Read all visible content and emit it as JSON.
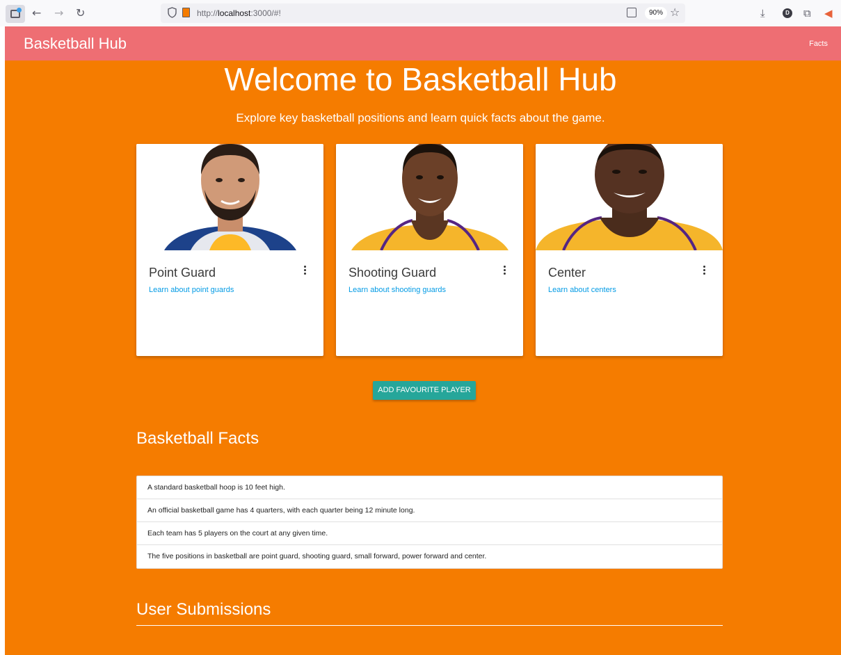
{
  "browser": {
    "url_prefix": "http://",
    "url_host": "localhost",
    "url_rest": ":3000/#!",
    "zoom": "90%",
    "profile_initial": "D"
  },
  "navbar": {
    "brand": "Basketball Hub",
    "links": [
      {
        "label": "Facts"
      }
    ]
  },
  "hero": {
    "title": "Welcome to Basketball Hub",
    "subtitle": "Explore key basketball positions and learn quick facts about the game."
  },
  "cards": [
    {
      "title": "Point Guard",
      "link": "Learn about point guards",
      "jersey_color": "#1d428a",
      "accent": "#fdb927"
    },
    {
      "title": "Shooting Guard",
      "link": "Learn about shooting guards",
      "jersey_color": "#f5b52b",
      "accent": "#552583"
    },
    {
      "title": "Center",
      "link": "Learn about centers",
      "jersey_color": "#f5b52b",
      "accent": "#552583"
    }
  ],
  "actions": {
    "add_favourite": "ADD FAVOURITE PLAYER"
  },
  "facts": {
    "title": "Basketball Facts",
    "items": [
      "A standard basketball hoop is 10 feet high.",
      "An official basketball game has 4 quarters, with each quarter being 12 minute long.",
      "Each team has 5 players on the court at any given time.",
      "The five positions in basketball are point guard, shooting guard, small forward, power forward and center."
    ]
  },
  "submissions": {
    "title": "User Submissions"
  },
  "colors": {
    "page_bg": "#f57c00",
    "navbar_bg": "#ee6e73",
    "button_bg": "#26a69a",
    "link": "#039be5"
  }
}
